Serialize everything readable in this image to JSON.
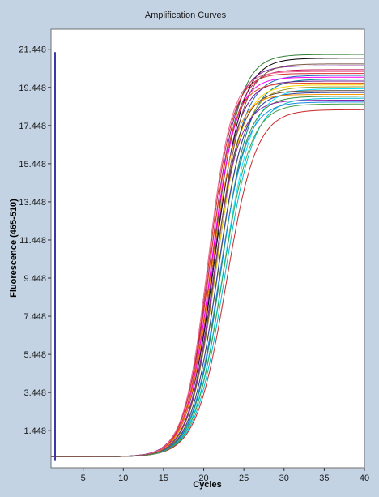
{
  "chart_data": {
    "type": "line",
    "title": "Amplification Curves",
    "xlabel": "Cycles",
    "ylabel": "Fluorescence (465-510)",
    "xlim": [
      1,
      40
    ],
    "ylim": [
      -0.5,
      22.5
    ],
    "x_ticks": [
      5,
      10,
      15,
      20,
      25,
      30,
      35,
      40
    ],
    "x_tick_labels": [
      "5",
      "10",
      "15",
      "20",
      "25",
      "30",
      "35",
      "40"
    ],
    "y_ticks": [
      1.448,
      3.448,
      5.448,
      7.448,
      9.448,
      11.448,
      13.448,
      15.448,
      17.448,
      19.448,
      21.448
    ],
    "y_tick_labels": [
      "1.448",
      "3.448",
      "5.448",
      "7.448",
      "9.448",
      "11.448",
      "13.448",
      "15.448",
      "17.448",
      "19.448",
      "21.448"
    ],
    "grid": false,
    "legend": "none",
    "baseline": 0.08,
    "left_marker_range": [
      -0.1,
      21.3
    ],
    "curve_model": "sigmoid: baseline + plateau / (1 + exp(-(x - midpoint) / slope))",
    "series": [
      {
        "color": "#2e7d32",
        "midpoint": 21.2,
        "plateau": 21.1,
        "slope": 1.65
      },
      {
        "color": "#000000",
        "midpoint": 21.4,
        "plateau": 20.9,
        "slope": 1.7
      },
      {
        "color": "#7b1fa2",
        "midpoint": 20.8,
        "plateau": 20.5,
        "slope": 1.6
      },
      {
        "color": "#c2185b",
        "midpoint": 21.0,
        "plateau": 20.3,
        "slope": 1.6
      },
      {
        "color": "#d32f2f",
        "midpoint": 20.6,
        "plateau": 20.1,
        "slope": 1.5
      },
      {
        "color": "#1565c0",
        "midpoint": 21.6,
        "plateau": 20.0,
        "slope": 1.7
      },
      {
        "color": "#ff00ff",
        "midpoint": 20.9,
        "plateau": 19.9,
        "slope": 1.55
      },
      {
        "color": "#00838f",
        "midpoint": 22.2,
        "plateau": 19.8,
        "slope": 1.75
      },
      {
        "color": "#6a1b9a",
        "midpoint": 21.1,
        "plateau": 19.7,
        "slope": 1.6
      },
      {
        "color": "#e64a19",
        "midpoint": 20.7,
        "plateau": 19.6,
        "slope": 1.5
      },
      {
        "color": "#ffd600",
        "midpoint": 21.5,
        "plateau": 19.5,
        "slope": 1.65
      },
      {
        "color": "#9e9d24",
        "midpoint": 21.8,
        "plateau": 19.4,
        "slope": 1.7
      },
      {
        "color": "#00e5ff",
        "midpoint": 22.4,
        "plateau": 19.3,
        "slope": 1.8
      },
      {
        "color": "#5d4037",
        "midpoint": 21.3,
        "plateau": 19.2,
        "slope": 1.6
      },
      {
        "color": "#303f9f",
        "midpoint": 21.7,
        "plateau": 19.1,
        "slope": 1.65
      },
      {
        "color": "#ff9800",
        "midpoint": 20.9,
        "plateau": 19.0,
        "slope": 1.55
      },
      {
        "color": "#388e3c",
        "midpoint": 22.0,
        "plateau": 18.9,
        "slope": 1.7
      },
      {
        "color": "#00bcd4",
        "midpoint": 22.6,
        "plateau": 18.8,
        "slope": 1.8
      },
      {
        "color": "#8e24aa",
        "midpoint": 21.2,
        "plateau": 18.7,
        "slope": 1.6
      },
      {
        "color": "#c62828",
        "midpoint": 22.8,
        "plateau": 18.2,
        "slope": 1.85
      },
      {
        "color": "#1e88e5",
        "midpoint": 21.9,
        "plateau": 18.6,
        "slope": 1.7
      },
      {
        "color": "#43a047",
        "midpoint": 22.3,
        "plateau": 18.5,
        "slope": 1.75
      },
      {
        "color": "#f06292",
        "midpoint": 20.5,
        "plateau": 20.2,
        "slope": 1.5
      },
      {
        "color": "#795548",
        "midpoint": 21.6,
        "plateau": 20.6,
        "slope": 1.65
      }
    ]
  }
}
